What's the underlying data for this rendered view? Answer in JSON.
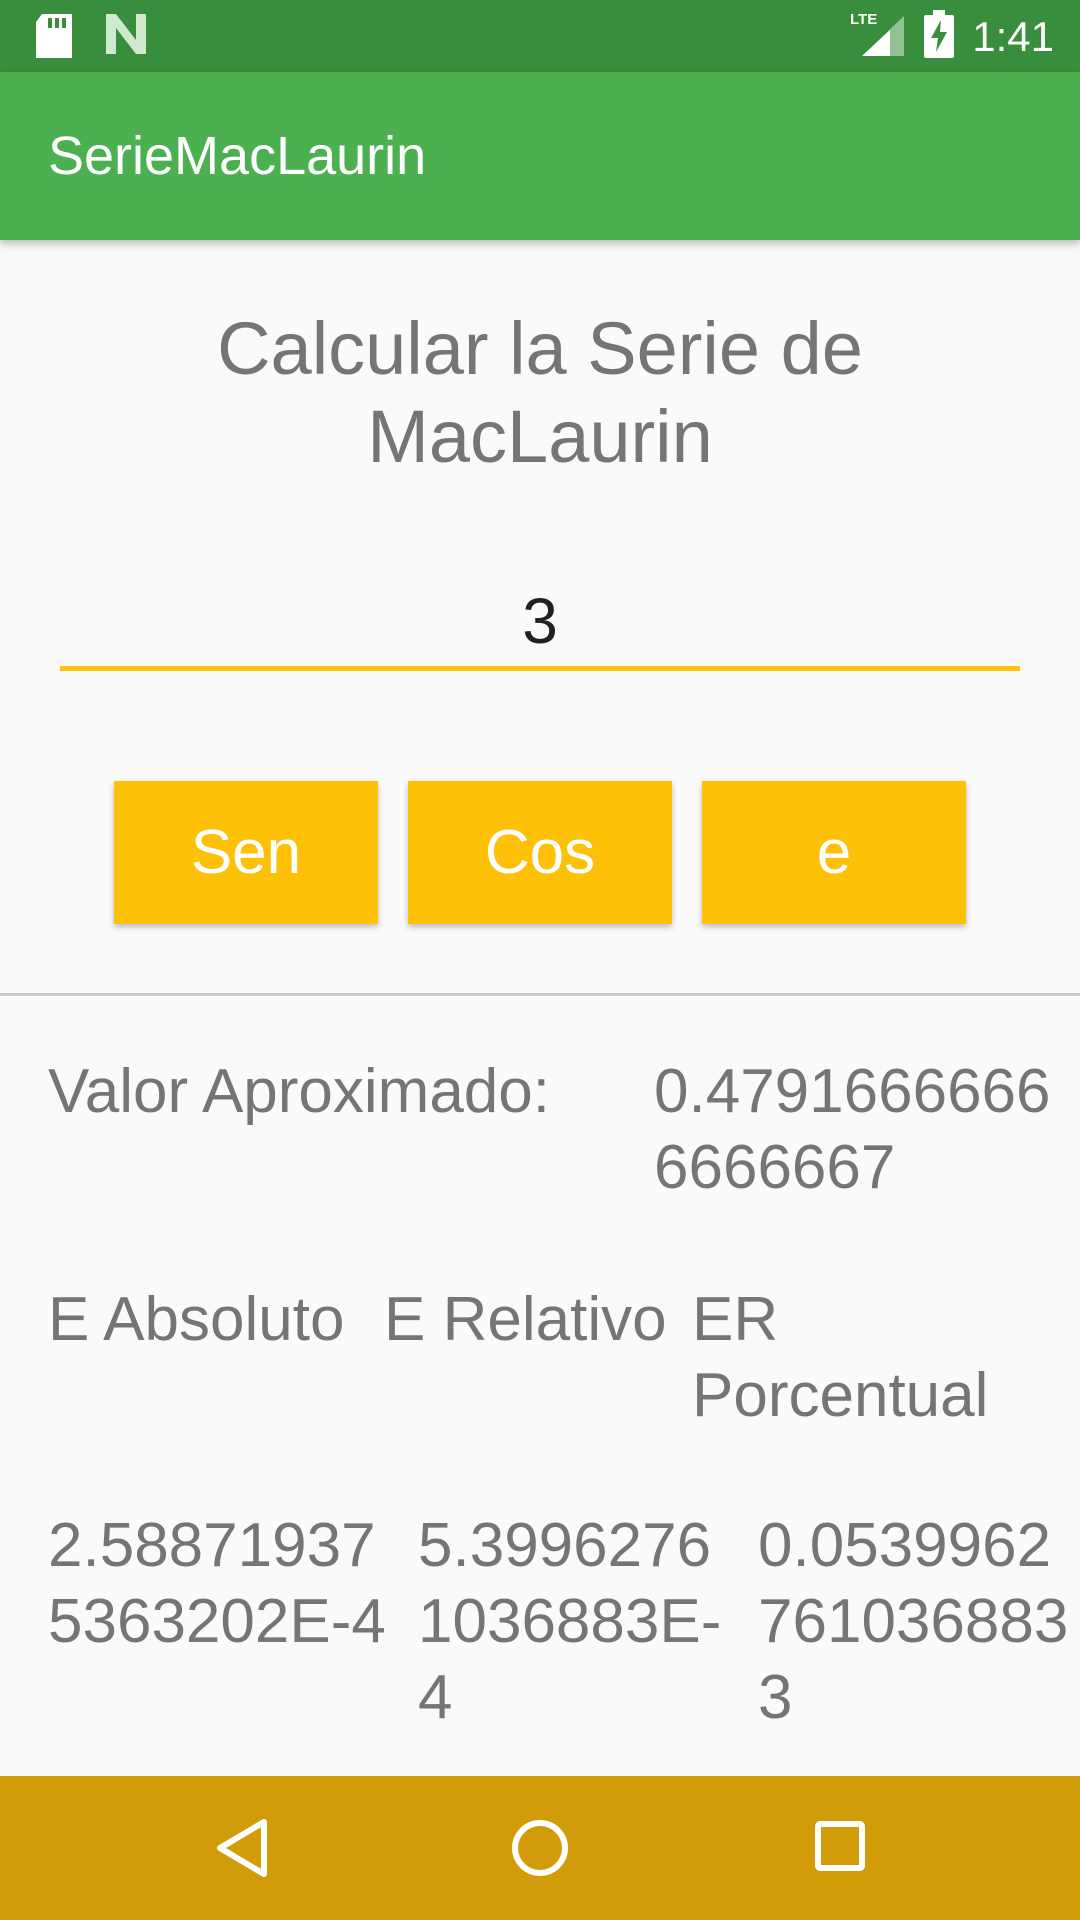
{
  "status_bar": {
    "time": "1:41",
    "network_label": "LTE",
    "icons": [
      "sd-card-icon",
      "notification-n-icon",
      "lte-signal-icon",
      "battery-charging-icon"
    ]
  },
  "app_bar": {
    "title": "SerieMacLaurin"
  },
  "heading": "Calcular la Serie de MacLaurin",
  "input": {
    "value": "3"
  },
  "buttons": {
    "sen": "Sen",
    "cos": "Cos",
    "e": "e"
  },
  "result": {
    "approx_label": "Valor Aproximado:",
    "approx_value": "0.47916666666666667"
  },
  "errors": {
    "headers": [
      "E Absoluto",
      "E Relativo",
      "ER Porcentual"
    ],
    "values": [
      "2.588719375363202E-4",
      "5.39962761036883E-4",
      "0.05399627610368833"
    ]
  },
  "colors": {
    "status_bar": "#388e3c",
    "app_bar": "#4caf50",
    "accent": "#ffc107",
    "nav_bar": "#d19c07",
    "text_secondary": "#757575"
  },
  "nav_bar": {
    "icons": [
      "back-icon",
      "home-icon",
      "recents-icon"
    ]
  }
}
